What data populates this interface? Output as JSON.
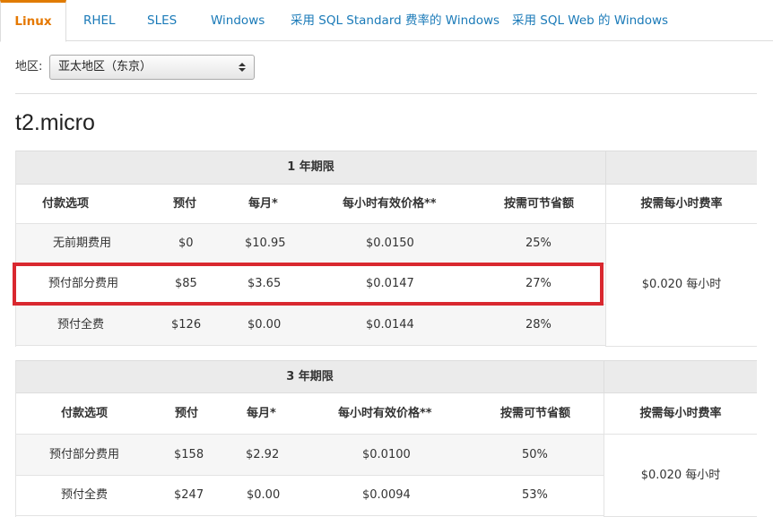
{
  "tabs": [
    {
      "label": "Linux",
      "active": true
    },
    {
      "label": "RHEL"
    },
    {
      "label": "SLES"
    },
    {
      "label": "Windows"
    },
    {
      "label": "采用 SQL Standard 费率的 Windows"
    },
    {
      "label": "采用 SQL Web 的 Windows"
    }
  ],
  "region": {
    "label": "地区:",
    "selected": "亚太地区（东京）"
  },
  "instance": {
    "title": "t2.micro"
  },
  "columns": [
    "付款选项",
    "预付",
    "每月*",
    "每小时有效价格**",
    "按需可节省额"
  ],
  "on_demand_header": "按需每小时费率",
  "term1": {
    "title": "1 年期限",
    "rows": [
      [
        "无前期费用",
        "$0",
        "$10.95",
        "$0.0150",
        "25%"
      ],
      [
        "预付部分费用",
        "$85",
        "$3.65",
        "$0.0147",
        "27%"
      ],
      [
        "预付全费",
        "$126",
        "$0.00",
        "$0.0144",
        "28%"
      ]
    ],
    "on_demand_rate": "$0.020 每小时"
  },
  "term3": {
    "title": "3 年期限",
    "rows": [
      [
        "预付部分费用",
        "$158",
        "$2.92",
        "$0.0100",
        "50%"
      ],
      [
        "预付全费",
        "$247",
        "$0.00",
        "$0.0094",
        "53%"
      ]
    ],
    "on_demand_rate": "$0.020 每小时"
  },
  "colors": {
    "tab_active": "#e57800",
    "tab_link": "#1a7ab8",
    "highlight": "#d9282f"
  }
}
